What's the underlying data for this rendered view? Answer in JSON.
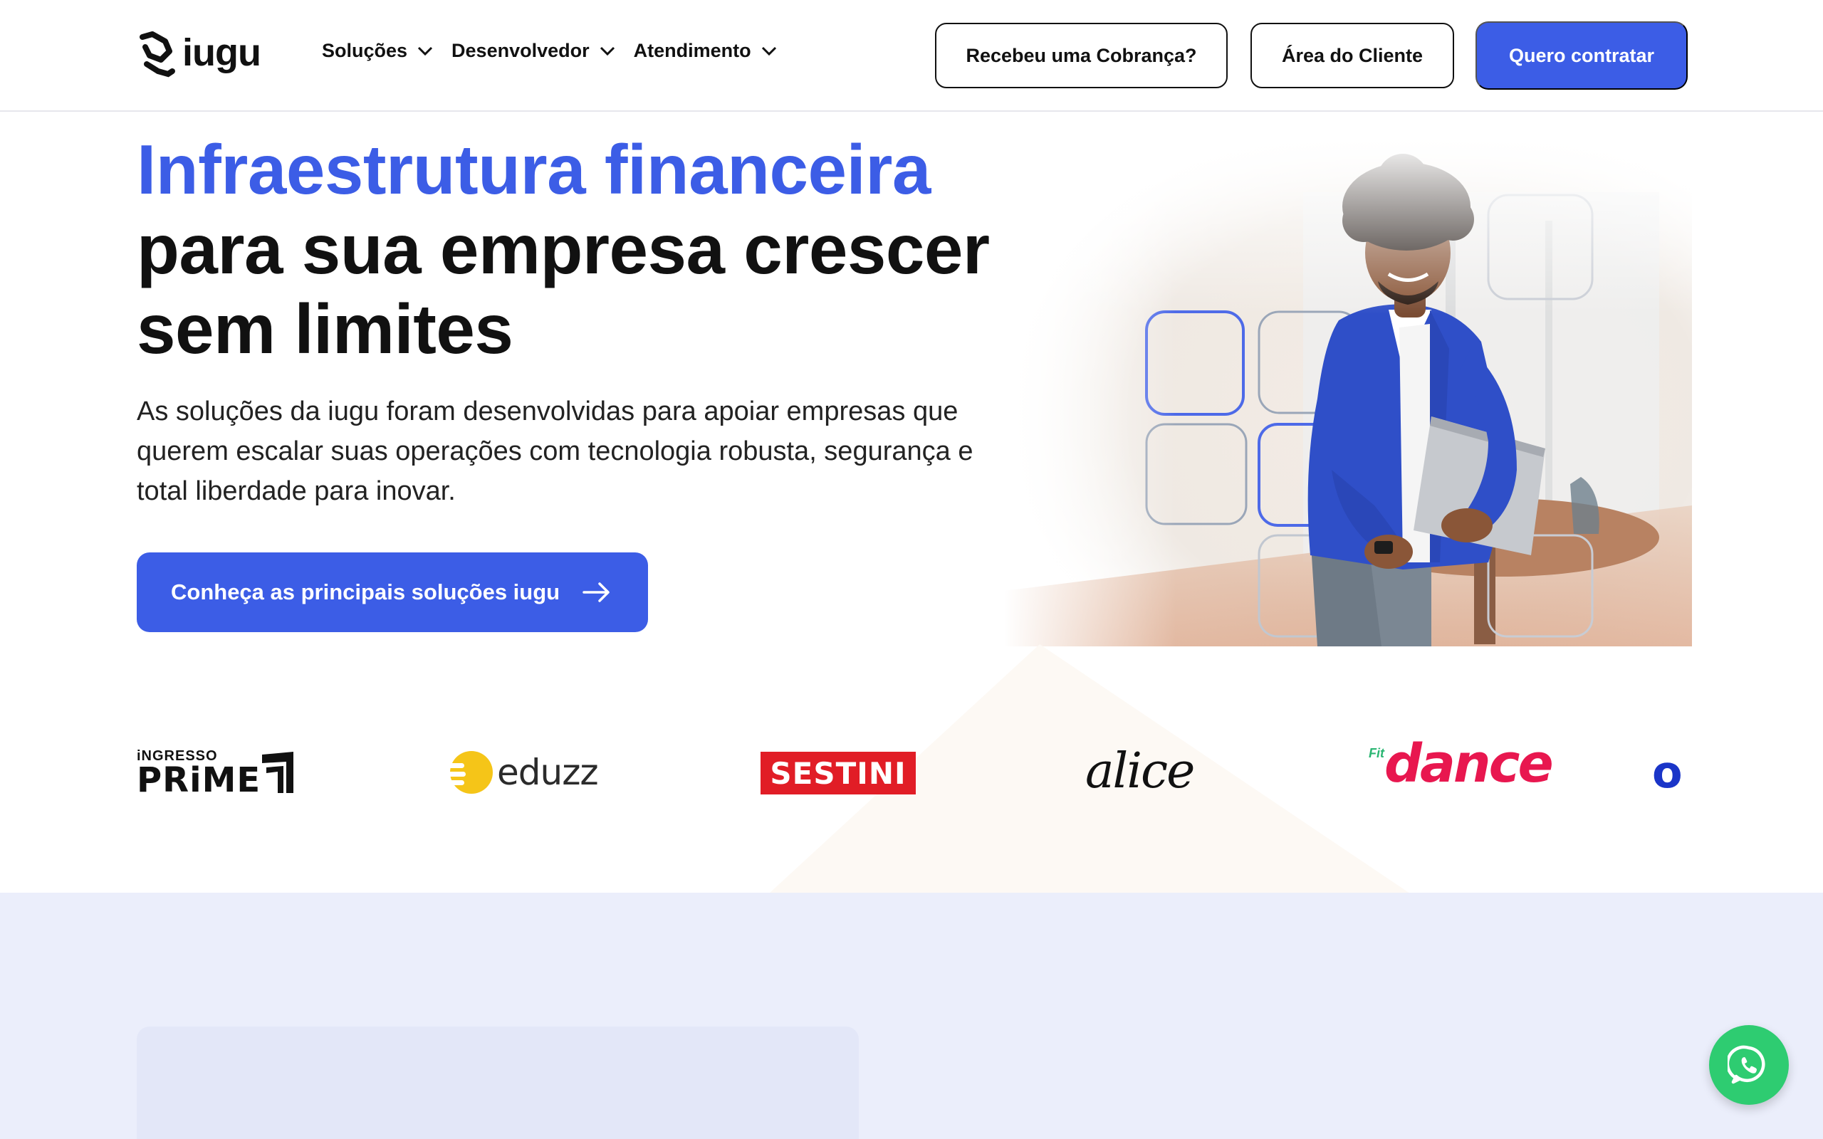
{
  "header": {
    "logo_text": "iugu",
    "nav": [
      {
        "label": "Soluções"
      },
      {
        "label": "Desenvolvedor"
      },
      {
        "label": "Atendimento"
      }
    ],
    "btn_cobranca": "Recebeu uma Cobrança?",
    "btn_area_cliente": "Área do Cliente",
    "btn_contratar": "Quero contratar"
  },
  "hero": {
    "title_accent": "Infraestrutura financeira",
    "title_rest": "para sua empresa crescer sem limites",
    "subtitle": "As soluções da iugu foram desenvolvidas para apoiar empresas que querem escalar suas operações com tecnologia robusta, segurança e total liberdade para inovar.",
    "cta_label": "Conheça as principais soluções iugu"
  },
  "clients": {
    "logos": [
      {
        "top": "iNGRESSO",
        "main": "PRiME"
      },
      {
        "main": "eduzz"
      },
      {
        "main": "SESTINI"
      },
      {
        "main": "alice"
      },
      {
        "top": "Fit",
        "main": "dance"
      },
      {
        "main": "o"
      }
    ]
  },
  "colors": {
    "accent": "#3c5de6",
    "whatsapp": "#2ecc71",
    "sestini": "#e11d26",
    "dance": "#e8174f",
    "eduzz": "#f5c518"
  }
}
